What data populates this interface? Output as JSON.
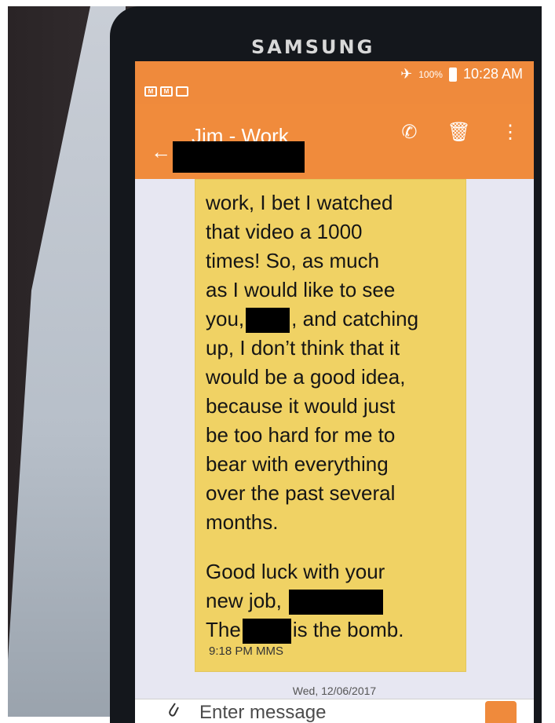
{
  "brand": "SAMSUNG",
  "status": {
    "battery": "100%",
    "time": "10:28 AM"
  },
  "header": {
    "contact": "Jim - Work"
  },
  "message": {
    "lines": {
      "l1": "work, I bet I watched",
      "l2": "that video a 1000",
      "l3": "times!  So, as much",
      "l4": "as I would like to see",
      "l5a": "you,",
      "l5b": ", and catching",
      "l6": "up, I don’t think that it",
      "l7": "would be a good idea,",
      "l8": "because it would just",
      "l9": "be too hard for me to",
      "l10": "bear with everything",
      "l11": "over the past several",
      "l12": "months.",
      "l13": "Good luck with your",
      "l14a": "new job,",
      "l15a": "The",
      "l15b": "is the bomb."
    },
    "meta": "9:18 PM MMS"
  },
  "date_divider": "Wed, 12/06/2017",
  "input": {
    "placeholder": "Enter message"
  },
  "icons": {
    "back": "back-arrow-icon",
    "call": "phone-icon",
    "delete": "trash-icon",
    "more": "more-vert-icon",
    "attach": "paperclip-icon",
    "airplane": "airplane-icon"
  },
  "colors": {
    "accent": "#ef8a3c",
    "bubble": "#f0d264"
  }
}
